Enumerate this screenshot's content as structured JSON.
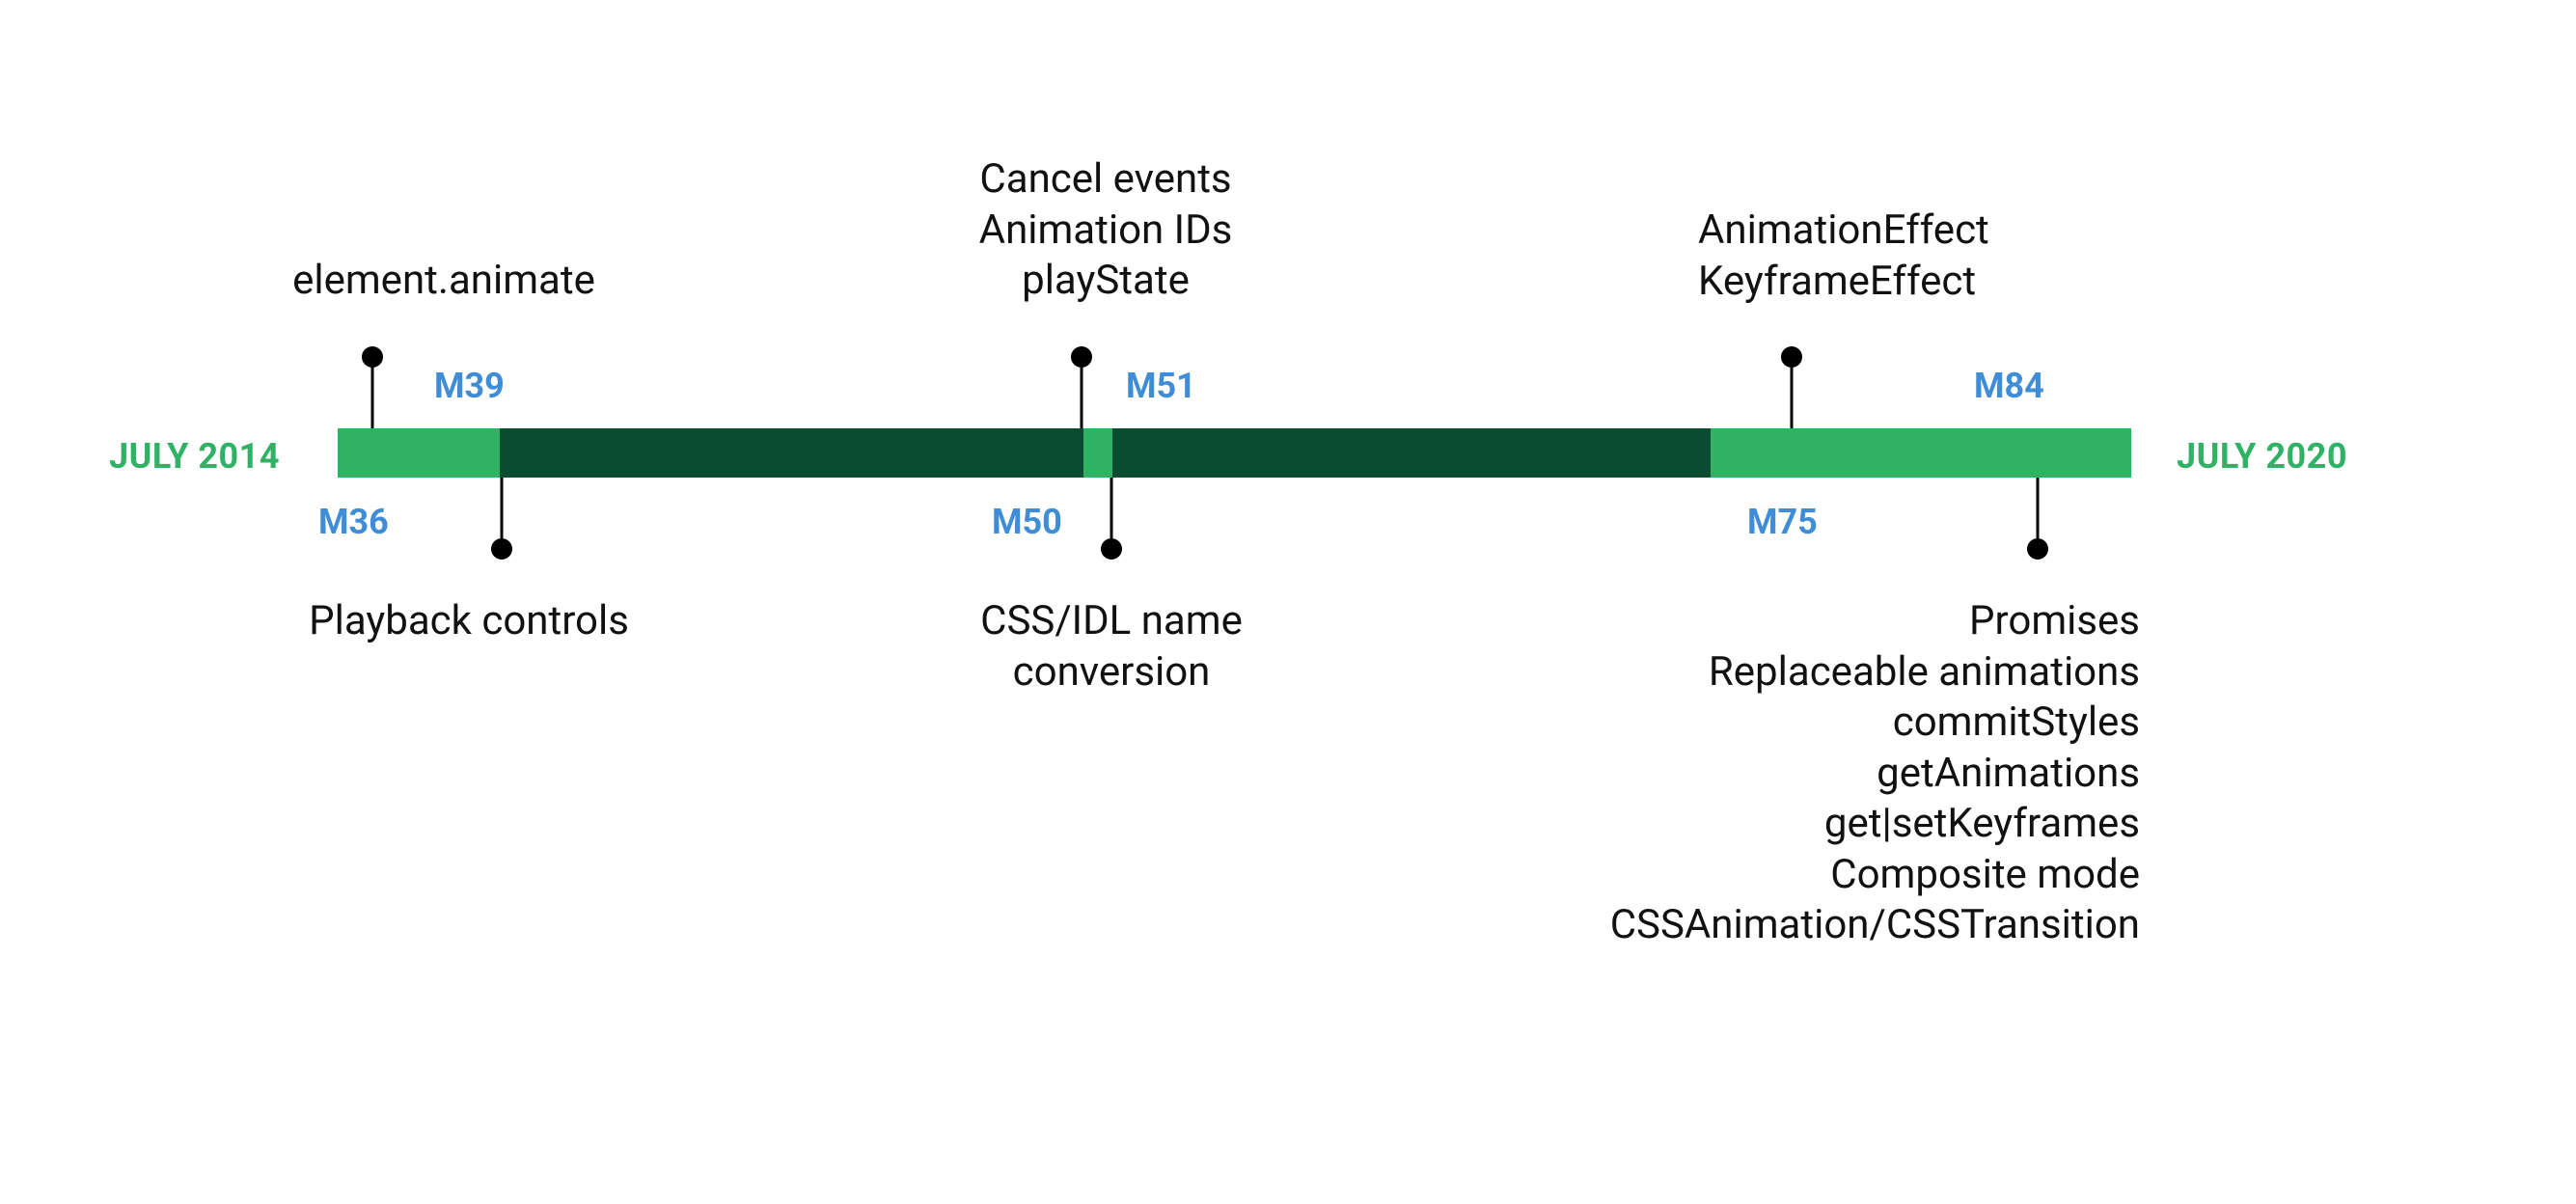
{
  "timeline": {
    "start_label": "JULY 2014",
    "end_label": "JULY 2020",
    "colors": {
      "light": "#2fb264",
      "dark": "#0a4c31",
      "milestone": "#3f8dd6"
    }
  },
  "milestones": {
    "m36": {
      "label": "M36",
      "features": [
        "element.animate"
      ]
    },
    "m39": {
      "label": "M39",
      "features": [
        "Playback controls"
      ]
    },
    "m50": {
      "label": "M50",
      "features": [
        "CSS/IDL name",
        "conversion"
      ]
    },
    "m51": {
      "label": "M51",
      "features": [
        "Cancel events",
        "Animation IDs",
        "playState"
      ]
    },
    "m75": {
      "label": "M75",
      "features": [
        "AnimationEffect",
        "KeyframeEffect"
      ]
    },
    "m84": {
      "label": "M84",
      "features": [
        "Promises",
        "Replaceable animations",
        "commitStyles",
        "getAnimations",
        "get|setKeyframes",
        "Composite mode",
        "CSSAnimation/CSSTransition"
      ]
    }
  }
}
